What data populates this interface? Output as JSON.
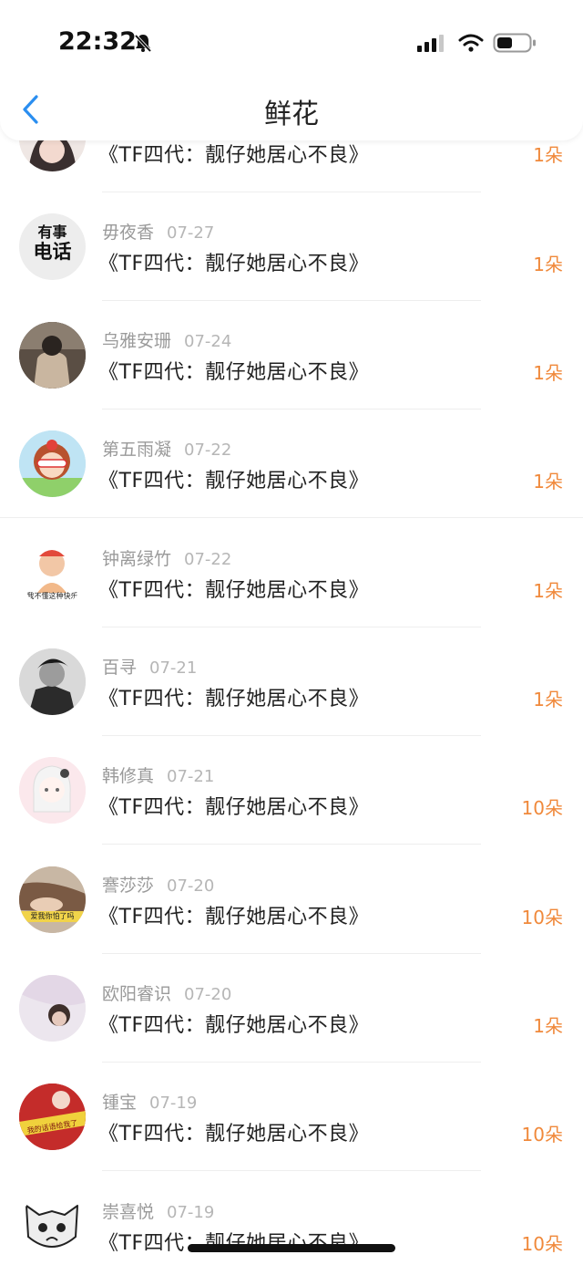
{
  "status_bar": {
    "time": "22:32"
  },
  "header": {
    "title": "鲜花"
  },
  "rows": [
    {
      "name": "",
      "date": "",
      "title": "《TF四代：靓仔她居心不良》",
      "count": "1朵"
    },
    {
      "name": "毋夜香",
      "date": "07-27",
      "title": "《TF四代：靓仔她居心不良》",
      "count": "1朵",
      "avatar_text": "有事\n电话"
    },
    {
      "name": "乌雅安珊",
      "date": "07-24",
      "title": "《TF四代：靓仔她居心不良》",
      "count": "1朵"
    },
    {
      "name": "第五雨凝",
      "date": "07-22",
      "title": "《TF四代：靓仔她居心不良》",
      "count": "1朵"
    },
    {
      "name": "钟离绿竹",
      "date": "07-22",
      "title": "《TF四代：靓仔她居心不良》",
      "count": "1朵",
      "avatar_caption": "我不懂这种快乐"
    },
    {
      "name": "百寻",
      "date": "07-21",
      "title": "《TF四代：靓仔她居心不良》",
      "count": "1朵"
    },
    {
      "name": "韩修真",
      "date": "07-21",
      "title": "《TF四代：靓仔她居心不良》",
      "count": "10朵"
    },
    {
      "name": "謇莎莎",
      "date": "07-20",
      "title": "《TF四代：靓仔她居心不良》",
      "count": "10朵",
      "avatar_caption": "爱我你怕了吗"
    },
    {
      "name": "欧阳睿识",
      "date": "07-20",
      "title": "《TF四代：靓仔她居心不良》",
      "count": "1朵"
    },
    {
      "name": "锺宝",
      "date": "07-19",
      "title": "《TF四代：靓仔她居心不良》",
      "count": "10朵",
      "avatar_caption": "我的话语给我了"
    },
    {
      "name": "崇喜悦",
      "date": "07-19",
      "title": "《TF四代：靓仔她居心不良》",
      "count": "10朵"
    }
  ],
  "colors": {
    "accent": "#f0893b",
    "back": "#2a8ef0"
  }
}
